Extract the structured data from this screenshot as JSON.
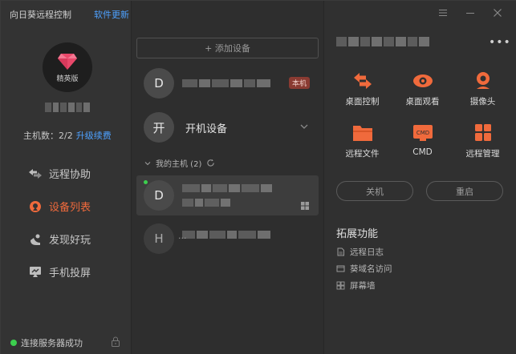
{
  "sidebar": {
    "app_title": "向日葵远程控制",
    "update_link": "软件更新",
    "edition": "精英版",
    "host_count_label": "主机数：2/2",
    "renew_link": "升级续费",
    "nav": [
      {
        "label": "远程协助",
        "icon": "remote-assist-icon"
      },
      {
        "label": "设备列表",
        "icon": "device-list-icon"
      },
      {
        "label": "发现好玩",
        "icon": "discover-icon"
      },
      {
        "label": "手机投屏",
        "icon": "screen-cast-icon"
      }
    ],
    "status_text": "连接服务器成功",
    "colors": {
      "accent": "#f06a3c",
      "link": "#4ea1ff",
      "online": "#3ccf4e"
    }
  },
  "middle": {
    "add_device": "+ 添加设备",
    "devices_top": [
      {
        "avatar": "D",
        "badge": "本机"
      },
      {
        "avatar": "开",
        "name": "开机设备"
      }
    ],
    "group_label": "我的主机 (2)",
    "my_hosts": [
      {
        "avatar": "D",
        "online": true,
        "os_icon": "windows-icon"
      },
      {
        "avatar": "H",
        "online": false,
        "extra": "..."
      }
    ]
  },
  "right": {
    "functions": [
      {
        "label": "桌面控制",
        "icon": "desktop-control-icon"
      },
      {
        "label": "桌面观看",
        "icon": "desktop-view-icon"
      },
      {
        "label": "摄像头",
        "icon": "camera-icon"
      },
      {
        "label": "远程文件",
        "icon": "remote-file-icon"
      },
      {
        "label": "CMD",
        "icon": "cmd-icon"
      },
      {
        "label": "远程管理",
        "icon": "remote-manage-icon"
      }
    ],
    "cmd_badge": "CMD",
    "shutdown": "关机",
    "restart": "重启",
    "ext_title": "拓展功能",
    "ext_items": [
      {
        "label": "远程日志",
        "icon": "log-icon"
      },
      {
        "label": "葵域名访问",
        "icon": "domain-icon"
      },
      {
        "label": "屏幕墙",
        "icon": "screen-wall-icon"
      }
    ]
  }
}
